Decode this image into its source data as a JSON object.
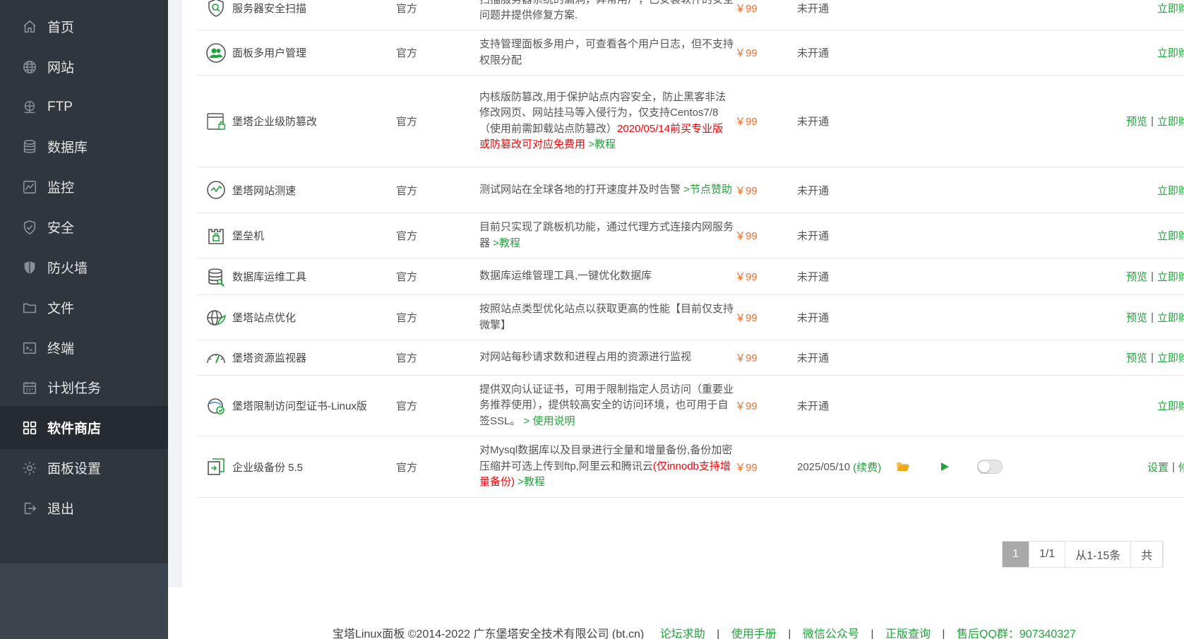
{
  "sidebar": {
    "items": [
      {
        "label": "首页",
        "icon": "home-icon"
      },
      {
        "label": "网站",
        "icon": "globe-icon"
      },
      {
        "label": "FTP",
        "icon": "ftp-icon"
      },
      {
        "label": "数据库",
        "icon": "database-icon"
      },
      {
        "label": "监控",
        "icon": "monitor-icon"
      },
      {
        "label": "安全",
        "icon": "shield-check-icon"
      },
      {
        "label": "防火墙",
        "icon": "firewall-icon"
      },
      {
        "label": "文件",
        "icon": "folder-icon"
      },
      {
        "label": "终端",
        "icon": "terminal-icon"
      },
      {
        "label": "计划任务",
        "icon": "calendar-icon"
      },
      {
        "label": "软件商店",
        "icon": "grid-icon",
        "active": true
      },
      {
        "label": "面板设置",
        "icon": "gear-icon"
      },
      {
        "label": "退出",
        "icon": "logout-icon"
      }
    ]
  },
  "colors": {
    "accent": "#20a53a",
    "price": "#fc6d26",
    "warning": "#ff0000",
    "sidebar_bg": "#30363d",
    "sidebar_active": "#262b31"
  },
  "plugins": [
    {
      "name": "服务器安全扫描",
      "developer": "官方",
      "icon": "shield-scan-icon",
      "desc": [
        {
          "t": "扫描服务器系统的漏洞，异常用户，已安装软件的安全问题并提供修复方案.",
          "s": "text"
        }
      ],
      "price": "￥99",
      "expire": "未开通",
      "ops": [
        "立即购买"
      ]
    },
    {
      "name": "面板多用户管理",
      "developer": "官方",
      "icon": "multi-user-icon",
      "desc": [
        {
          "t": "支持管理面板多用户，可查看各个用户日志，但不支持权限分配",
          "s": "text"
        }
      ],
      "price": "￥99",
      "expire": "未开通",
      "ops": [
        "立即购买"
      ]
    },
    {
      "name": "堡塔企业级防篡改",
      "developer": "官方",
      "icon": "tamper-proof-icon",
      "desc": [
        {
          "t": "内核版防篡改,用于保护站点内容安全，防止黑客非法修改网页、网站挂马等入侵行为，仅支持Centos7/8（使用前需卸载站点防篡改）",
          "s": "text"
        },
        {
          "t": "2020/05/14前买专业版或防篡改可对应免费用",
          "s": "red"
        },
        {
          "t": " >教程",
          "s": "link"
        }
      ],
      "price": "￥99",
      "expire": "未开通",
      "ops": [
        "预览",
        "立即购买"
      ]
    },
    {
      "name": "堡塔网站测速",
      "developer": "官方",
      "icon": "speed-test-icon",
      "desc": [
        {
          "t": "测试网站在全球各地的打开速度并及时告警",
          "s": "text"
        },
        {
          "t": " >节点赞助",
          "s": "link"
        }
      ],
      "price": "￥99",
      "expire": "未开通",
      "ops": [
        "立即购买"
      ]
    },
    {
      "name": "堡垒机",
      "developer": "官方",
      "icon": "bastion-icon",
      "desc": [
        {
          "t": "目前只实现了跳板机功能，通过代理方式连接内网服务器",
          "s": "text"
        },
        {
          "t": " >教程",
          "s": "link"
        }
      ],
      "price": "￥99",
      "expire": "未开通",
      "ops": [
        "立即购买"
      ]
    },
    {
      "name": "数据库运维工具",
      "developer": "官方",
      "icon": "db-tool-icon",
      "desc": [
        {
          "t": "数据库运维管理工具,一键优化数据库",
          "s": "text"
        }
      ],
      "price": "￥99",
      "expire": "未开通",
      "ops": [
        "预览",
        "立即购买"
      ]
    },
    {
      "name": "堡塔站点优化",
      "developer": "官方",
      "icon": "site-optimize-icon",
      "desc": [
        {
          "t": "按照站点类型优化站点以获取更高的性能【目前仅支持微擎】",
          "s": "text"
        }
      ],
      "price": "￥99",
      "expire": "未开通",
      "ops": [
        "预览",
        "立即购买"
      ]
    },
    {
      "name": "堡塔资源监视器",
      "developer": "官方",
      "icon": "gauge-icon",
      "desc": [
        {
          "t": "对网站每秒请求数和进程占用的资源进行监视",
          "s": "text"
        }
      ],
      "price": "￥99",
      "expire": "未开通",
      "ops": [
        "预览",
        "立即购买"
      ]
    },
    {
      "name": "堡塔限制访问型证书-Linux版",
      "developer": "官方",
      "icon": "certificate-icon",
      "desc": [
        {
          "t": "提供双向认证证书，可用于限制指定人员访问（重要业务推荐使用），提供较高安全的访问环境，也可用于自签SSL。",
          "s": "text"
        },
        {
          "t": " > 使用说明",
          "s": "link"
        }
      ],
      "price": "￥99",
      "expire": "未开通",
      "ops": [
        "立即购买"
      ]
    },
    {
      "name": "企业级备份 5.5",
      "developer": "官方",
      "icon": "backup-icon",
      "desc": [
        {
          "t": "对Mysql数据库以及目录进行全量和增量备份,备份加密压缩并可选上传到ftp,阿里云和腾讯云",
          "s": "text"
        },
        {
          "t": "(仅innodb支持增量备份)",
          "s": "red"
        },
        {
          "t": " >教程",
          "s": "link"
        }
      ],
      "price": "￥99",
      "expire": "2025/05/10",
      "renew": "(续费)",
      "ops": [
        "设置",
        "修复"
      ]
    }
  ],
  "pagination": {
    "current": "1",
    "pages": "1/1",
    "range": "从1-15条",
    "total": "共"
  },
  "footer": {
    "copyright": "宝塔Linux面板 ©2014-2022 广东堡塔安全技术有限公司 (bt.cn)",
    "links": [
      "论坛求助",
      "使用手册",
      "微信公众号",
      "正版查询",
      "售后QQ群：907340327"
    ]
  }
}
